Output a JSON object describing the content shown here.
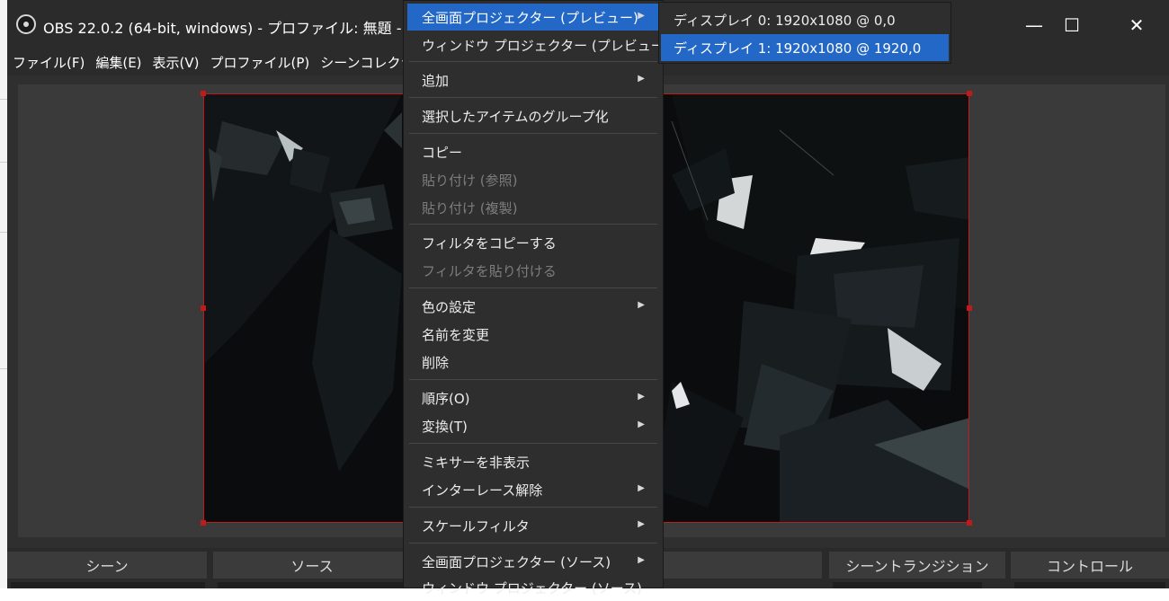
{
  "window": {
    "title": "OBS 22.0.2 (64-bit, windows) - プロファイル: 無題 - シ",
    "controls": {
      "minimize": "—",
      "maximize": "☐",
      "close": "✕"
    }
  },
  "menubar": [
    "ファイル(F)",
    "編集(E)",
    "表示(V)",
    "プロファイル(P)",
    "シーンコレクション(S"
  ],
  "context_menu": {
    "items": [
      {
        "label": "全画面プロジェクター (プレビュー)",
        "has_submenu": true,
        "enabled": true,
        "active": true
      },
      {
        "label": "ウィンドウ プロジェクター (プレビュー)",
        "has_submenu": false,
        "enabled": true
      },
      {
        "label": "追加",
        "has_submenu": true,
        "enabled": true
      },
      {
        "label": "選択したアイテムのグループ化",
        "has_submenu": false,
        "enabled": true
      },
      {
        "label": "コピー",
        "has_submenu": false,
        "enabled": true
      },
      {
        "label": "貼り付け (参照)",
        "has_submenu": false,
        "enabled": false
      },
      {
        "label": "貼り付け (複製)",
        "has_submenu": false,
        "enabled": false
      },
      {
        "label": "フィルタをコピーする",
        "has_submenu": false,
        "enabled": true
      },
      {
        "label": "フィルタを貼り付ける",
        "has_submenu": false,
        "enabled": false
      },
      {
        "label": "色の設定",
        "has_submenu": true,
        "enabled": true
      },
      {
        "label": "名前を変更",
        "has_submenu": false,
        "enabled": true
      },
      {
        "label": "削除",
        "has_submenu": false,
        "enabled": true
      },
      {
        "label": "順序(O)",
        "has_submenu": true,
        "enabled": true
      },
      {
        "label": "変換(T)",
        "has_submenu": true,
        "enabled": true
      },
      {
        "label": "ミキサーを非表示",
        "has_submenu": false,
        "enabled": true
      },
      {
        "label": "インターレース解除",
        "has_submenu": true,
        "enabled": true
      },
      {
        "label": "スケールフィルタ",
        "has_submenu": true,
        "enabled": true
      },
      {
        "label": "全画面プロジェクター (ソース)",
        "has_submenu": true,
        "enabled": true
      },
      {
        "label": "ウィンドウ プロジェクター (ソース)",
        "has_submenu": false,
        "enabled": true
      }
    ]
  },
  "submenu": {
    "items": [
      {
        "label": "ディスプレイ 0: 1920x1080 @ 0,0"
      },
      {
        "label": "ディスプレイ 1: 1920x1080 @ 1920,0",
        "active": true
      }
    ]
  },
  "docks": {
    "scenes": "シーン",
    "sources": "ソース",
    "transitions": "シーントランジション",
    "controls": "コントロール"
  },
  "colors": {
    "accent": "#2468c7",
    "selection_border": "#c21a1a",
    "window_bg": "#2f2f2f"
  }
}
